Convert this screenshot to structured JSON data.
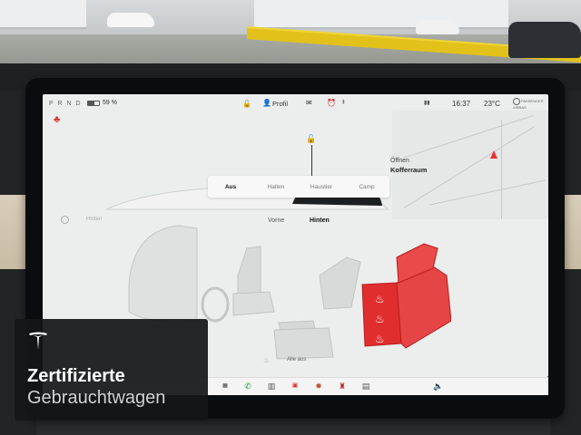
{
  "status_bar": {
    "gear": "P R N D",
    "battery_percent": "59 %",
    "battery_level": 0.59,
    "profile_label": "Profil",
    "time": "16:37",
    "temperature": "23°C",
    "airbag_text": "PASSENGER AIRBAG"
  },
  "vehicle": {
    "trunk_open_label": "Öffnen",
    "trunk_label": "Kofferraum"
  },
  "climate_modes": [
    {
      "label": "Aus",
      "active": true
    },
    {
      "label": "Halten",
      "active": false
    },
    {
      "label": "Haustier",
      "active": false
    },
    {
      "label": "Camp",
      "active": false
    }
  ],
  "climate": {
    "power_label": "Hinten",
    "tabs": [
      {
        "label": "Vorne",
        "active": false
      },
      {
        "label": "Hinten",
        "active": true
      }
    ],
    "all_off_label": "Alle aus"
  },
  "overlay": {
    "line1": "Zertifizierte",
    "line2": "Gebrauchtwagen"
  },
  "colors": {
    "seat_heat_red": "#e02e2e",
    "nav_arrow_red": "#e33333",
    "rail_yellow": "#e2c21a"
  },
  "icons": [
    "lock-icon",
    "profile-icon",
    "wifi-icon",
    "alarm-icon",
    "bluetooth-icon",
    "seatbelt-icon",
    "power-icon",
    "seat-heater-icon",
    "phone-icon",
    "calendar-icon",
    "volume-icon"
  ]
}
